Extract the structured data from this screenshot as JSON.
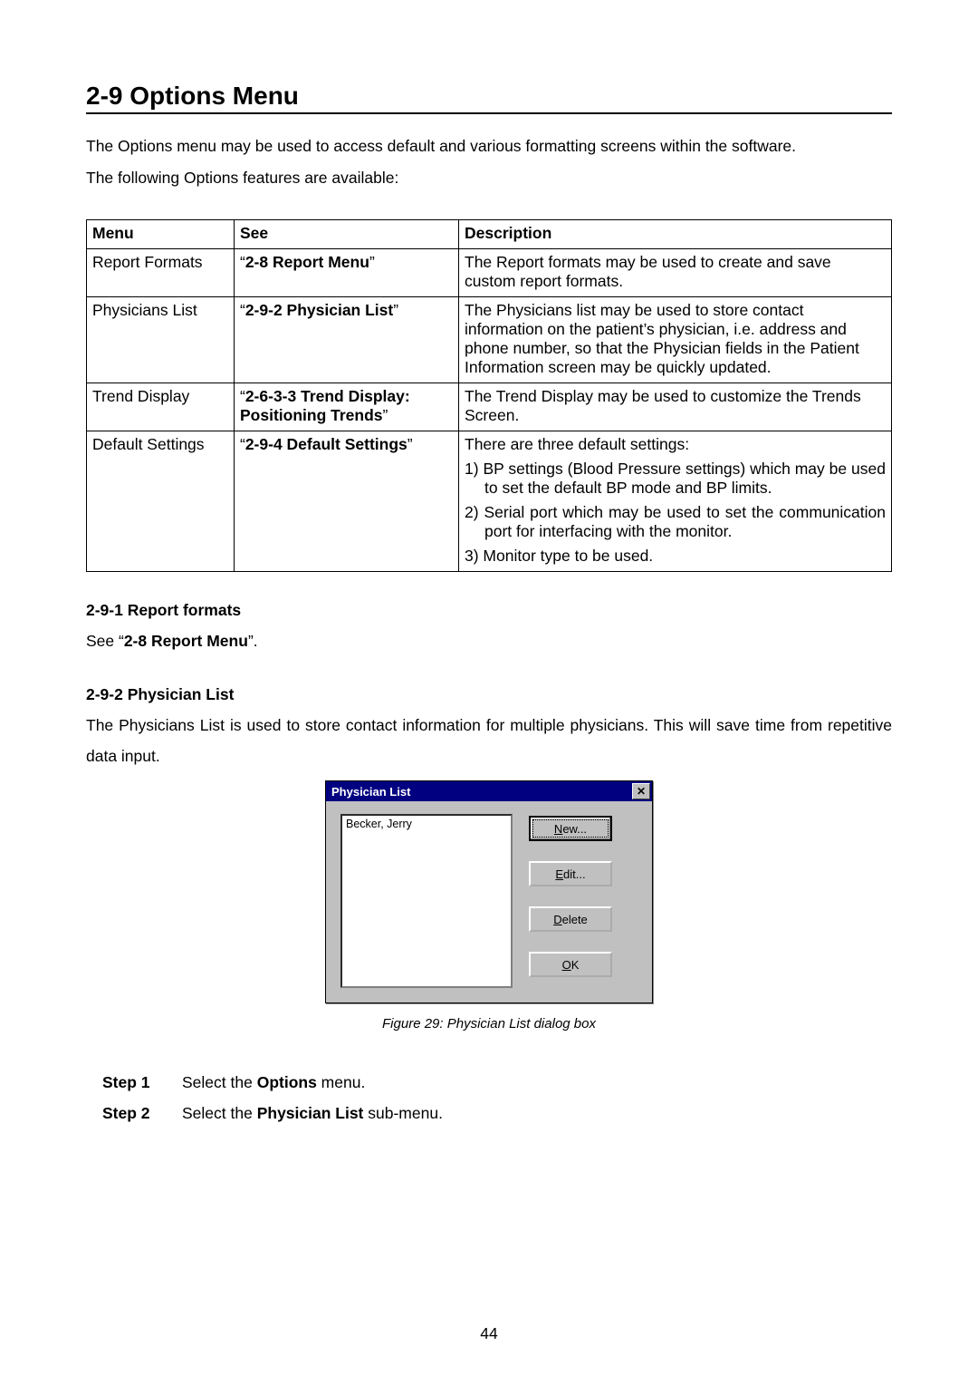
{
  "heading": "2-9 Options Menu",
  "intro_line1": "The Options menu may be used to access default and various formatting screens within the software.",
  "intro_line2": "The following Options features are available:",
  "table": {
    "head": {
      "c1": "Menu",
      "c2": "See",
      "c3": "Description"
    },
    "rows": [
      {
        "menu": "Report Formats",
        "see_pre": "“",
        "see_bold": "2-8 Report Menu",
        "see_post": "”",
        "desc": "The Report formats may be used to create and save custom report formats."
      },
      {
        "menu": "Physicians List",
        "see_pre": "“",
        "see_bold": "2-9-2 Physician List",
        "see_post": "”",
        "desc": "The Physicians list may be used to store contact information on the patient’s physician, i.e. address and phone number, so that the Physician fields in the Patient Information screen may be quickly updated."
      },
      {
        "menu": "Trend Display",
        "see_pre": "“",
        "see_bold": "2-6-3-3 Trend Display: Positioning Trends",
        "see_post": "”",
        "desc": "The Trend Display may be used to customize the Trends Screen."
      },
      {
        "menu": "Default Settings",
        "see_pre": "“",
        "see_bold": "2-9-4 Default Settings",
        "see_post": "”",
        "desc_intro": "There are three default settings:",
        "ol": [
          "1) BP settings (Blood Pressure settings) which may be used to set the default BP mode and BP limits.",
          "2) Serial port which may be used to set the communication port for interfacing with the monitor.",
          "3) Monitor type to be used."
        ]
      }
    ]
  },
  "sec1": {
    "title": "2-9-1 Report formats",
    "text_pre": "See “",
    "text_bold": "2-8 Report Menu",
    "text_post": "”."
  },
  "sec2": {
    "title": "2-9-2 Physician List",
    "text": "The Physicians List is used to store contact information for multiple physicians. This will save time from repetitive data input."
  },
  "dialog": {
    "title": "Physician List",
    "close": "✕",
    "list_item": "Becker, Jerry",
    "btn_new": {
      "u": "N",
      "rest": "ew..."
    },
    "btn_edit": {
      "u": "E",
      "rest": "dit..."
    },
    "btn_delete": {
      "u": "D",
      "rest": "elete"
    },
    "btn_ok": {
      "u": "O",
      "rest": "K"
    }
  },
  "caption": "Figure 29: Physician List dialog box",
  "steps": {
    "s1_label": "Step 1",
    "s1_pre": "Select the ",
    "s1_bold": "Options",
    "s1_post": " menu.",
    "s2_label": "Step 2",
    "s2_pre": "Select the ",
    "s2_bold": "Physician List",
    "s2_post": " sub-menu."
  },
  "page_number": "44"
}
